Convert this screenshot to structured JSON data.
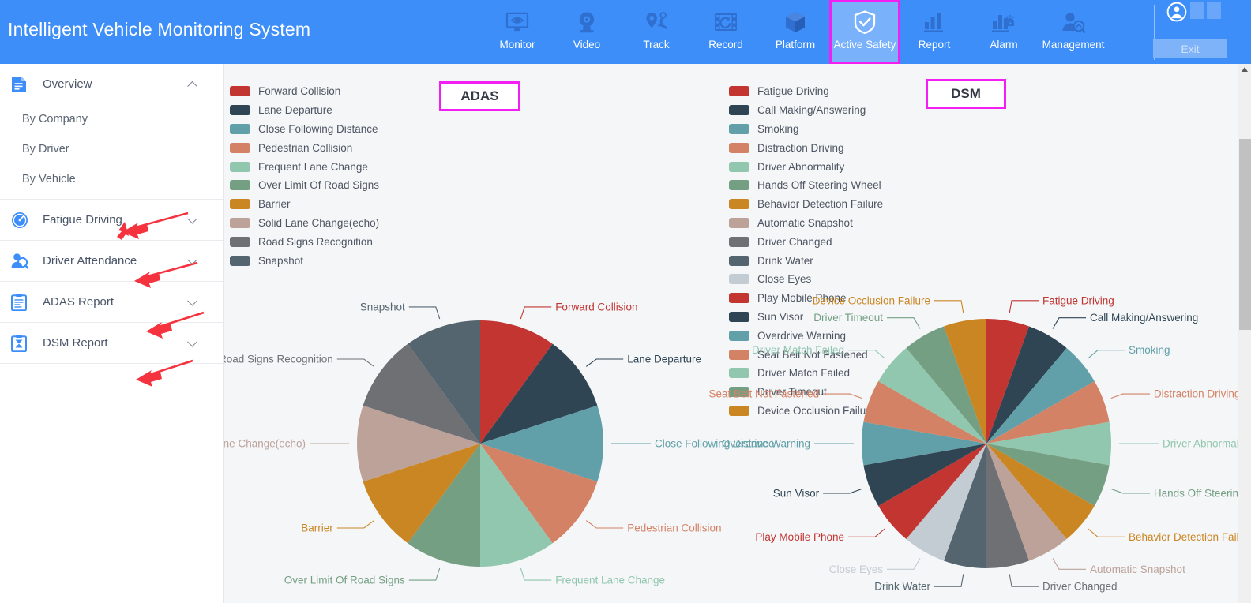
{
  "header": {
    "title": "Intelligent Vehicle Monitoring System",
    "nav": [
      {
        "label": "Monitor",
        "icon": "monitor-eye-icon",
        "active": false
      },
      {
        "label": "Video",
        "icon": "camera-icon",
        "active": false
      },
      {
        "label": "Track",
        "icon": "map-pin-route-icon",
        "active": false
      },
      {
        "label": "Record",
        "icon": "film-replay-icon",
        "active": false
      },
      {
        "label": "Platform",
        "icon": "cube-icon",
        "active": false
      },
      {
        "label": "Active Safety",
        "icon": "shield-check-icon",
        "active": true
      },
      {
        "label": "Report",
        "icon": "bar-chart-icon",
        "active": false
      },
      {
        "label": "Alarm",
        "icon": "alarm-chart-icon",
        "active": false
      },
      {
        "label": "Management",
        "icon": "user-search-icon",
        "active": false
      }
    ],
    "exit_label": "Exit",
    "user_icon": "user-avatar-icon",
    "accent": "#3d8ef8",
    "highlight": "#f21ef2"
  },
  "sidebar": {
    "groups": [
      {
        "label": "Overview",
        "icon": "document-icon",
        "expanded": true,
        "chevron": "chevron-up-icon",
        "arrow": false,
        "items": [
          {
            "label": "By Company"
          },
          {
            "label": "By Driver"
          },
          {
            "label": "By Vehicle"
          }
        ]
      },
      {
        "label": "Fatigue Driving",
        "icon": "gauge-icon",
        "expanded": false,
        "chevron": "chevron-down-icon",
        "arrow": true,
        "items": []
      },
      {
        "label": "Driver Attendance",
        "icon": "driver-search-icon",
        "expanded": false,
        "chevron": "chevron-down-icon",
        "arrow": true,
        "items": []
      },
      {
        "label": "ADAS Report",
        "icon": "clipboard-adas-icon",
        "expanded": false,
        "chevron": "chevron-down-icon",
        "arrow": true,
        "items": []
      },
      {
        "label": "DSM Report",
        "icon": "clipboard-dsm-icon",
        "expanded": false,
        "chevron": "chevron-down-icon",
        "arrow": true,
        "items": []
      }
    ]
  },
  "chart_data": [
    {
      "type": "pie",
      "title": "ADAS",
      "legend_position": "top-left",
      "categories": [
        "Forward Collision",
        "Lane Departure",
        "Close Following Distance",
        "Pedestrian Collision",
        "Frequent Lane Change",
        "Over Limit Of Road Signs",
        "Barrier",
        "Solid Lane Change(echo)",
        "Road Signs Recognition",
        "Snapshot"
      ],
      "values": [
        10,
        10,
        10,
        10,
        10,
        10,
        10,
        10,
        10,
        10
      ],
      "colors": [
        "#c23531",
        "#2f4554",
        "#61a0a8",
        "#d48265",
        "#91c7ae",
        "#749f83",
        "#ca8622",
        "#bda29a",
        "#6e7074",
        "#546570"
      ]
    },
    {
      "type": "pie",
      "title": "DSM",
      "legend_position": "top-left",
      "categories": [
        "Fatigue Driving",
        "Call Making/Answering",
        "Smoking",
        "Distraction Driving",
        "Driver Abnormality",
        "Hands Off Steering Wheel",
        "Behavior Detection Failure",
        "Automatic Snapshot",
        "Driver Changed",
        "Drink Water",
        "Close Eyes",
        "Play Mobile Phone",
        "Sun Visor",
        "Overdrive Warning",
        "Seat Belt Not Fastened",
        "Driver Match Failed",
        "Driver Timeout",
        "Device Occlusion Failure"
      ],
      "values": [
        1,
        1,
        1,
        1,
        1,
        1,
        1,
        1,
        1,
        1,
        1,
        1,
        1,
        1,
        1,
        1,
        1,
        1
      ],
      "colors": [
        "#c23531",
        "#2f4554",
        "#61a0a8",
        "#d48265",
        "#91c7ae",
        "#749f83",
        "#ca8622",
        "#bda29a",
        "#6e7074",
        "#546570",
        "#c4ccd3",
        "#c23531",
        "#2f4554",
        "#61a0a8",
        "#d48265",
        "#91c7ae",
        "#749f83",
        "#ca8622"
      ]
    }
  ],
  "scrollbar": {
    "orientation": "vertical",
    "position": "right"
  }
}
